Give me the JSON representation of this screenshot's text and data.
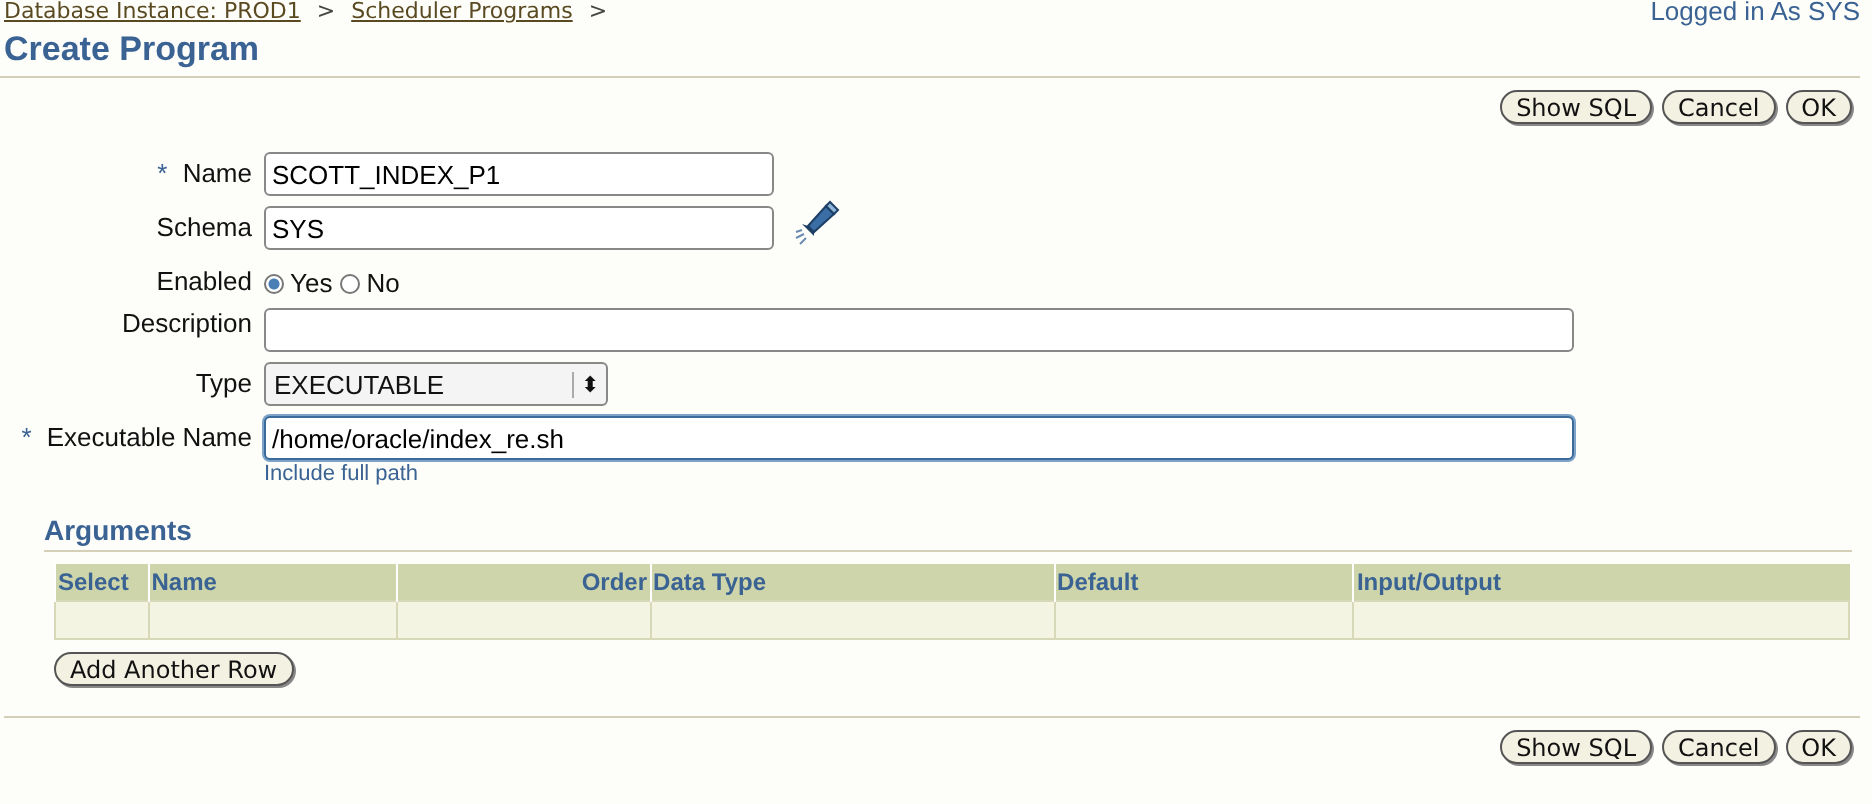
{
  "breadcrumbs": [
    {
      "label": "Database Instance: PROD1",
      "separator": ">"
    },
    {
      "label": "Scheduler Programs",
      "separator": ">"
    }
  ],
  "user_info": "Logged in As SYS",
  "title": "Create Program",
  "top_buttons": [
    "Show SQL",
    "Cancel",
    "OK"
  ],
  "fields": [
    {
      "kind": "text",
      "label": "Name",
      "required_mark": "*",
      "value": "SCOTT_INDEX_P1"
    },
    {
      "kind": "text",
      "label": "Schema",
      "value": "SYS",
      "lookup": true
    },
    {
      "kind": "radio",
      "label": "Enabled",
      "options": [
        {
          "label": "Yes",
          "selected": true
        },
        {
          "label": "No",
          "selected": false
        }
      ]
    },
    {
      "kind": "long_text",
      "label": "Description"
    },
    {
      "kind": "select",
      "label": "Type",
      "value": "EXECUTABLE",
      "arrow": "⬍"
    },
    {
      "kind": "long_text",
      "label": "Executable Name",
      "required_mark": "*",
      "value": "/home/oracle/index_re.sh",
      "focused": true,
      "hint": "Include full path"
    }
  ],
  "arguments": {
    "title": "Arguments",
    "columns": [
      "Select",
      "Name",
      "Order",
      "Data Type",
      "Default",
      "Input/Output"
    ],
    "add_button": "Add Another Row"
  },
  "bottom_buttons": [
    "Show SQL",
    "Cancel",
    "OK"
  ]
}
